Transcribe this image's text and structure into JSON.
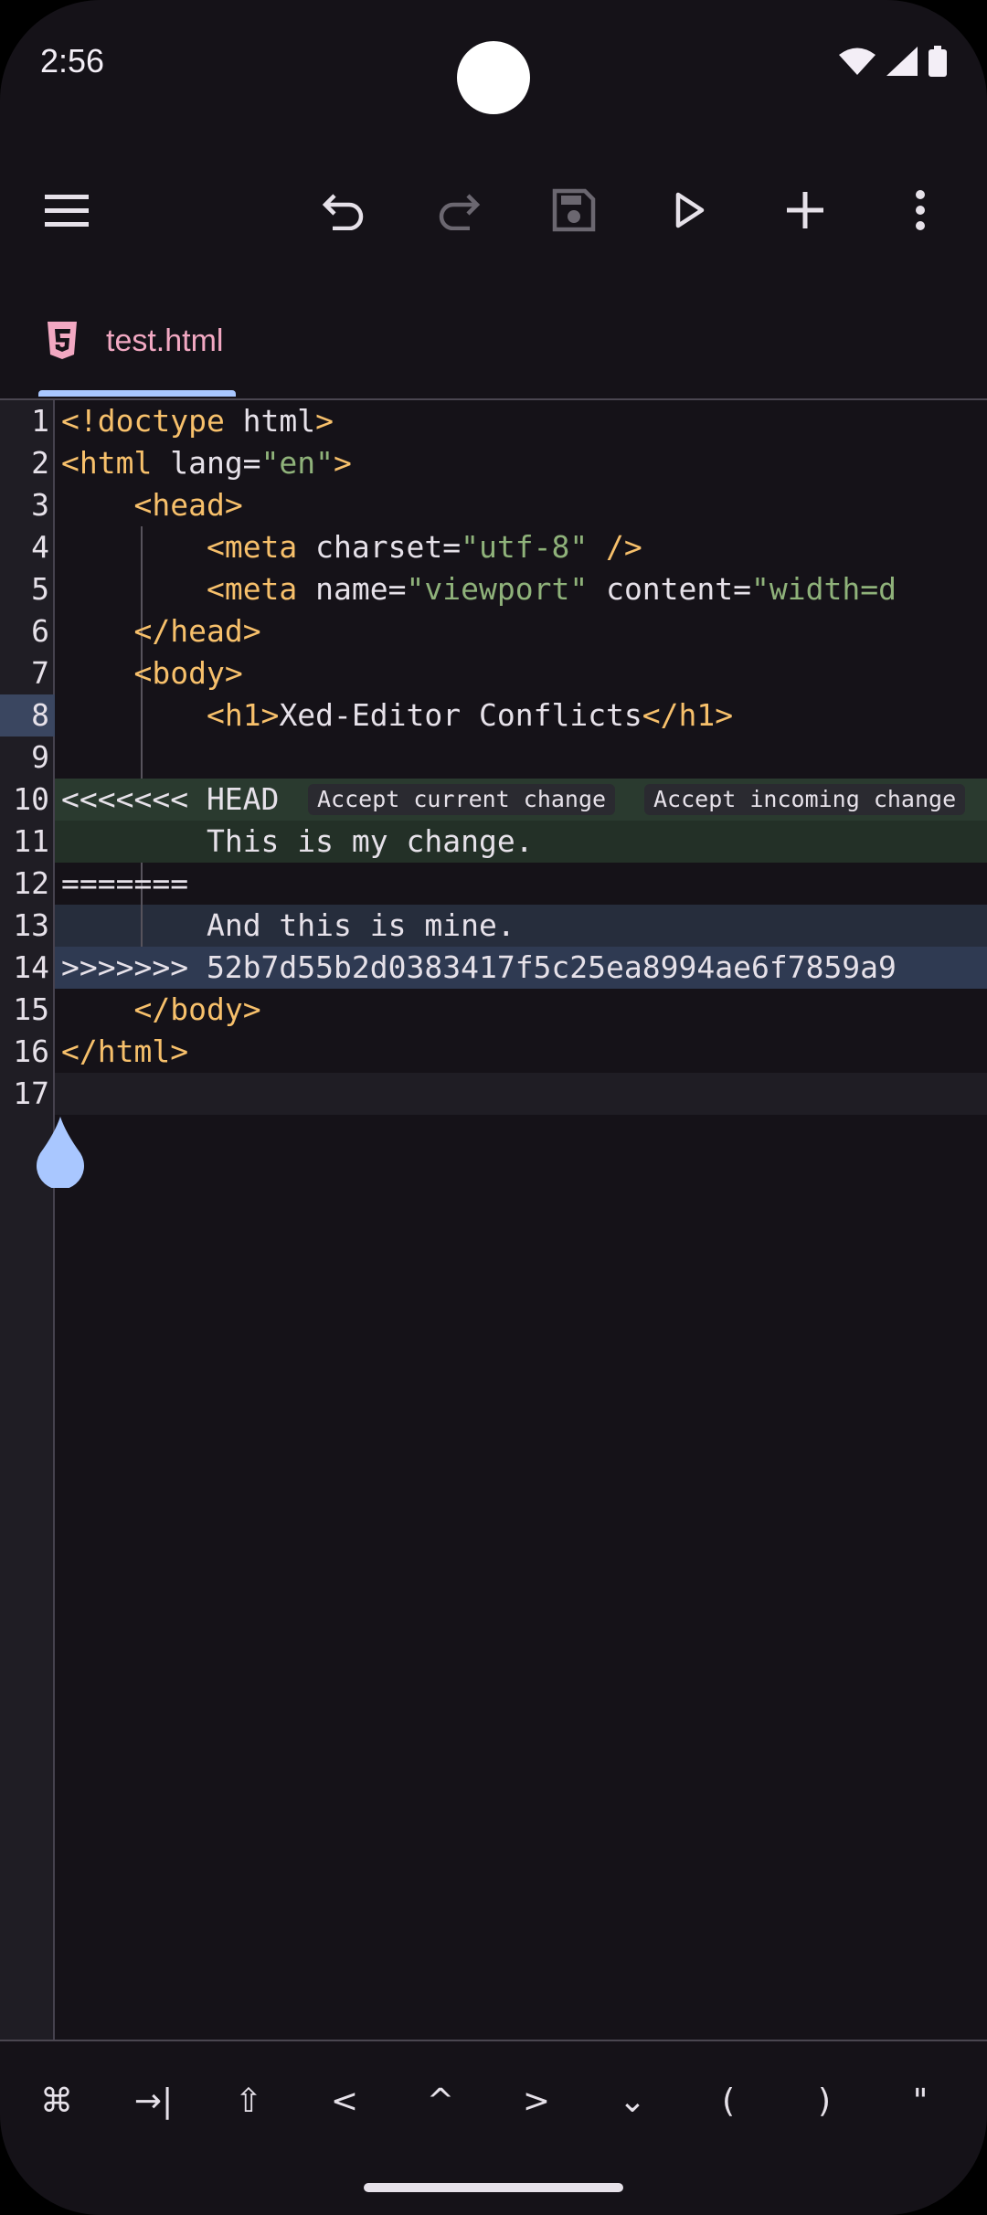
{
  "status": {
    "time": "2:56"
  },
  "toolbar": {
    "menu_icon": "hamburger-menu-icon",
    "undo_icon": "undo-icon",
    "redo_icon": "redo-icon",
    "save_icon": "save-icon",
    "run_icon": "play-icon",
    "add_icon": "plus-icon",
    "more_icon": "more-vert-icon"
  },
  "tab": {
    "label": "test.html",
    "icon": "html5-icon",
    "accent": "#f2a8c2"
  },
  "editor": {
    "lines": [
      {
        "num": "1"
      },
      {
        "num": "2"
      },
      {
        "num": "3"
      },
      {
        "num": "4"
      },
      {
        "num": "5"
      },
      {
        "num": "6"
      },
      {
        "num": "7"
      },
      {
        "num": "8"
      },
      {
        "num": "9"
      },
      {
        "num": "10"
      },
      {
        "num": "11"
      },
      {
        "num": "12"
      },
      {
        "num": "13"
      },
      {
        "num": "14"
      },
      {
        "num": "15"
      },
      {
        "num": "16"
      },
      {
        "num": "17"
      }
    ],
    "code": {
      "l1_tag": "<!doctype",
      "l1_rest": " html",
      "l1_close": ">",
      "l2_open": "<html",
      "l2_attr": " lang=",
      "l2_str": "\"en\"",
      "l2_close": ">",
      "l3": "<head>",
      "l4_open": "<meta",
      "l4_attr": " charset=",
      "l4_str": "\"utf-8\"",
      "l4_close": " />",
      "l5_open": "<meta",
      "l5_attr1": " name=",
      "l5_str1": "\"viewport\"",
      "l5_attr2": " content=",
      "l5_str2": "\"width=d",
      "l6": "</head>",
      "l7": "<body>",
      "l8_open": "<h1>",
      "l8_text": "Xed-Editor Conflicts",
      "l8_close": "</h1>",
      "l10_marker": "<<<<<<< HEAD",
      "l11": "This is my change.",
      "l12": "=======",
      "l13": "And this is mine.",
      "l14": ">>>>>>> 52b7d55b2d0383417f5c25ea8994ae6f7859a9",
      "l15": "</body>",
      "l16": "</html>"
    },
    "conflict_actions": {
      "accept_current": "Accept current change",
      "accept_incoming": "Accept incoming change"
    },
    "colors": {
      "current_bg": "#263229",
      "incoming_bg": "#262d3c",
      "incoming_marker_bg": "#2f3a52",
      "tag": "#f7c06b",
      "string": "#8fb27a"
    }
  },
  "keys": [
    "⌘",
    "→|",
    "⇧",
    "<",
    "^",
    ">",
    "⌄",
    "(",
    ")",
    "\""
  ]
}
